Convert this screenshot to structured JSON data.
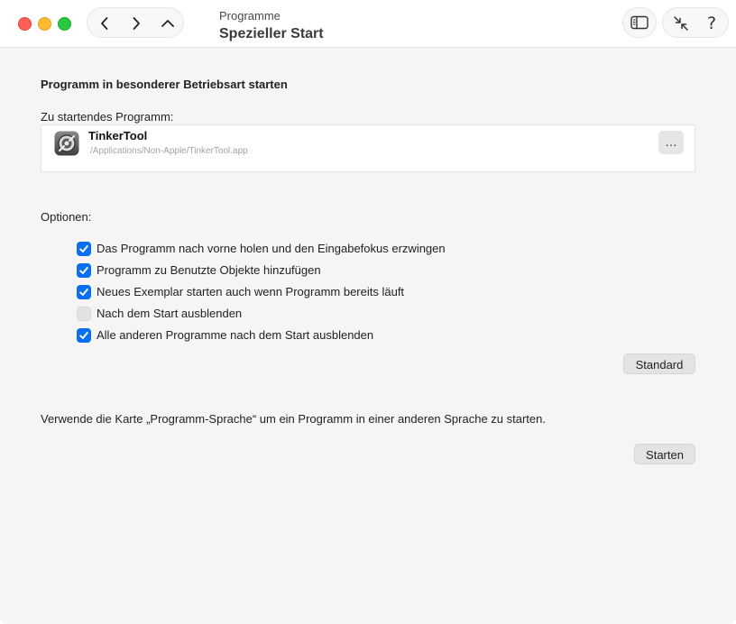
{
  "window": {
    "subtitle": "Programme",
    "title": "Spezieller Start",
    "help_label": "?"
  },
  "section": {
    "heading": "Programm in besonderer Betriebsart starten",
    "program_label": "Zu startendes Programm:",
    "program_name": "TinkerTool",
    "program_path": "/Applications/Non-Apple/TinkerTool.app",
    "browse_label": "…"
  },
  "options": {
    "label": "Optionen:",
    "items": [
      {
        "label": "Das Programm nach vorne holen und den Eingabefokus erzwingen",
        "checked": true
      },
      {
        "label": "Programm zu Benutzte Objekte hinzufügen",
        "checked": true
      },
      {
        "label": "Neues Exemplar starten auch wenn Programm bereits läuft",
        "checked": true
      },
      {
        "label": "Nach dem Start ausblenden",
        "checked": false
      },
      {
        "label": "Alle anderen Programme nach dem Start ausblenden",
        "checked": true
      }
    ],
    "standard_button": "Standard"
  },
  "footer": {
    "note": "Verwende die Karte „Programm-Sprache“ um ein Programm in einer anderen Sprache zu starten.",
    "start_button": "Starten"
  },
  "colors": {
    "accent": "#0a6ef0",
    "close": "#ff5f57",
    "minimize": "#febc2e",
    "zoom": "#28c840"
  },
  "icons": {
    "back": "chevron-left-icon",
    "forward": "chevron-right-icon",
    "up": "chevron-up-icon",
    "sidebar": "sidebar-icon",
    "collapse": "arrows-collapse-icon",
    "help": "question-mark-icon",
    "app": "tinkertool-app-icon"
  }
}
